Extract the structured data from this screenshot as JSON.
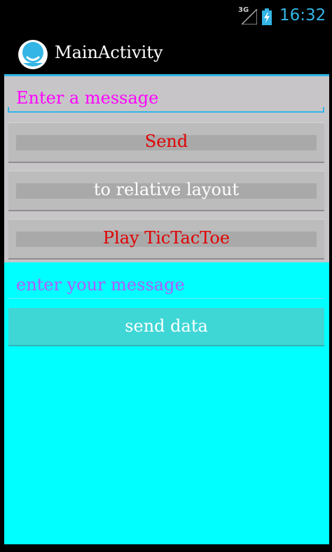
{
  "status_bar": {
    "network": "3G",
    "time": "16:32",
    "signal_icon": "signal-icon",
    "battery_icon": "battery-charging-icon",
    "time_color": "#33b5e5"
  },
  "action_bar": {
    "title": "MainActivity",
    "icon": "app-launcher-icon"
  },
  "main": {
    "message_input": {
      "placeholder": "Enter a message",
      "value": ""
    },
    "buttons": {
      "send": "Send",
      "relative_layout": "to relative layout",
      "tictactoe": "Play TicTacToe"
    },
    "data_input": {
      "placeholder": "enter your message",
      "value": ""
    },
    "send_data_button": "send data"
  },
  "colors": {
    "accent": "#33b5e5",
    "content_bg": "#c7c5c8",
    "cyan_panel": "#00ffff",
    "red_text": "#e00000",
    "magenta_text": "#ff00ff",
    "purple_text": "#b05bff"
  }
}
